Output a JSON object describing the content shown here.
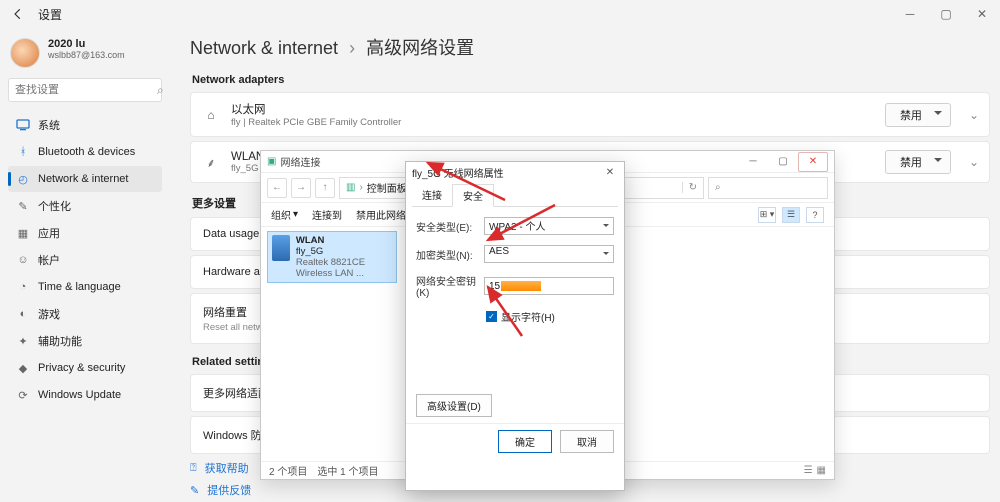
{
  "app": {
    "title": "设置"
  },
  "user": {
    "name": "2020 lu",
    "email": "wslbb87@163.com"
  },
  "search": {
    "placeholder": "查找设置"
  },
  "nav": {
    "items": [
      {
        "label": "系统"
      },
      {
        "label": "Bluetooth & devices"
      },
      {
        "label": "Network & internet"
      },
      {
        "label": "个性化"
      },
      {
        "label": "应用"
      },
      {
        "label": "帐户"
      },
      {
        "label": "Time & language"
      },
      {
        "label": "游戏"
      },
      {
        "label": "辅助功能"
      },
      {
        "label": "Privacy & security"
      },
      {
        "label": "Windows Update"
      }
    ]
  },
  "breadcrumb": {
    "a": "Network & internet",
    "b": "高级网络设置"
  },
  "adapters": {
    "heading": "Network adapters",
    "ethernet": {
      "title": "以太网",
      "sub": "fly | Realtek PCIe GBE Family Controller",
      "action": "禁用"
    },
    "wlan": {
      "title": "WLAN",
      "sub": "fly_5G | Realtek 8821CE Wireless LAN 802.11ac PCI-E NIC",
      "action": "禁用"
    }
  },
  "more": {
    "heading": "更多设置",
    "data_usage": "Data usage",
    "hw": "Hardware and connection properties",
    "reset_title": "网络重置",
    "reset_sub": "Reset all network adapters"
  },
  "related": {
    "heading": "Related settings",
    "more_adapter": "更多网络适配器选项",
    "firewall": "Windows 防火墙"
  },
  "help": {
    "get_help": "获取帮助",
    "feedback": "提供反馈"
  },
  "nc": {
    "title": "网络连接",
    "path_seg": "控制面板",
    "toolbar": {
      "org": "组织",
      "connect": "连接到",
      "disable": "禁用此网络设备"
    },
    "wlan": {
      "name": "WLAN",
      "ssid": "fly_5G",
      "adapter": "Realtek 8821CE Wireless LAN ..."
    },
    "status": {
      "count": "2 个项目",
      "selected": "选中 1 个项目"
    }
  },
  "prop": {
    "title": "fly_5G 无线网络属性",
    "tab_conn": "连接",
    "tab_sec": "安全",
    "sec_type_label": "安全类型(E):",
    "sec_type_val": "WPA2 - 个人",
    "enc_label": "加密类型(N):",
    "enc_val": "AES",
    "key_label": "网络安全密钥(K)",
    "key_prefix": "15",
    "show_chars": "显示字符(H)",
    "advanced": "高级设置(D)",
    "ok": "确定",
    "cancel": "取消"
  }
}
